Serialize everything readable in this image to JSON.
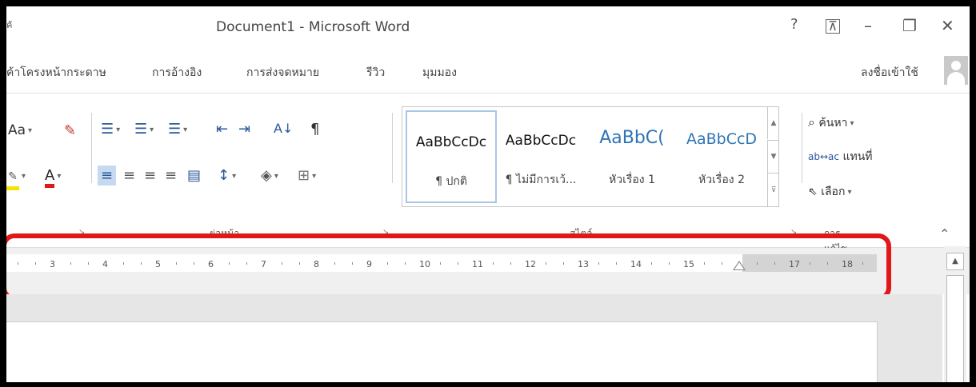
{
  "titlebar": {
    "title": "Document1 - Microsoft Word",
    "help": "?",
    "ribbon_display": "⊼",
    "minimize": "–",
    "restore": "❐",
    "close": "✕"
  },
  "tabs": [
    {
      "label": "ค้าโครงหน้ากระดาษ"
    },
    {
      "label": "การอ้างอิง"
    },
    {
      "label": "การส่งจดหมาย"
    },
    {
      "label": "รีวิว"
    },
    {
      "label": "มุมมอง"
    }
  ],
  "signin": "ลงชื่อเข้าใช้",
  "font_group": {
    "change_case": "Aa",
    "clear_format": "✎",
    "highlight": "ab",
    "font_color": "A"
  },
  "paragraph_group": {
    "label": "ย่อหน้า",
    "sort": "A↓",
    "pilcrow": "¶"
  },
  "styles_group": {
    "label": "สไตล์",
    "items": [
      {
        "preview": "AaBbCcDc",
        "name": "¶ ปกติ"
      },
      {
        "preview": "AaBbCcDc",
        "name": "¶ ไม่มีการเว้..."
      },
      {
        "preview": "AaBbC(",
        "name": "หัวเรื่อง 1"
      },
      {
        "preview": "AaBbCcD",
        "name": "หัวเรื่อง 2"
      }
    ]
  },
  "editing_group": {
    "label": "การแก้ไข",
    "find": "ค้นหา",
    "replace": "แทนที่",
    "select": "เลือก"
  },
  "ruler": {
    "marks": [
      "3",
      "4",
      "5",
      "6",
      "7",
      "8",
      "9",
      "10",
      "11",
      "12",
      "13",
      "14",
      "15",
      "17",
      "18"
    ]
  },
  "colors": {
    "accent": "#2b579a",
    "highlight_frame": "#e01818",
    "heading_style": "#2e74b5"
  }
}
